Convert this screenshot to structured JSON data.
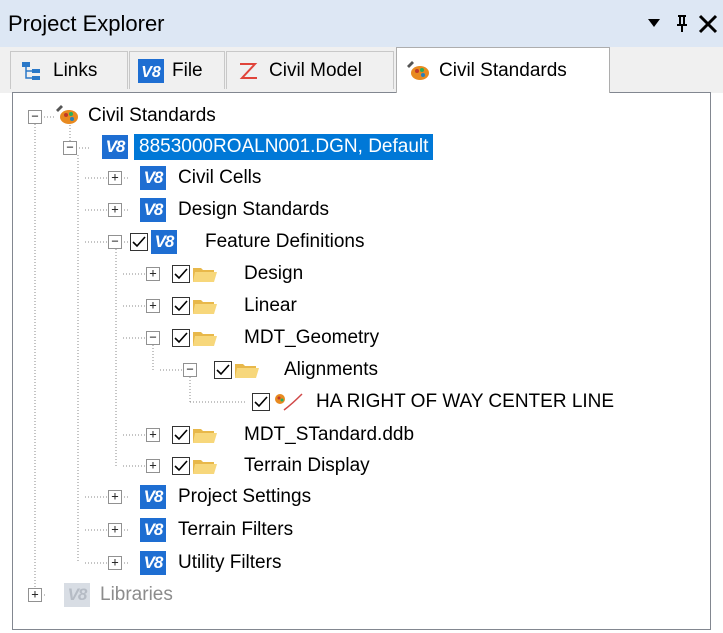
{
  "window": {
    "title": "Project Explorer",
    "dropdown_glyph": "▼",
    "pin_glyph": "ᵖ",
    "close_glyph": "✕"
  },
  "tabs": [
    {
      "label": "Links",
      "icon": "links-icon",
      "active": false
    },
    {
      "label": "File",
      "icon": "v8-icon",
      "active": false
    },
    {
      "label": "Civil Model",
      "icon": "civil-model-icon",
      "active": false
    },
    {
      "label": "Civil Standards",
      "icon": "civil-standards-icon",
      "active": true
    }
  ],
  "tree": {
    "root_label": "Civil Standards",
    "dgn_label": "8853000ROALN001.DGN, Default",
    "civil_cells": "Civil Cells",
    "design_standards": "Design Standards",
    "feature_definitions": "Feature Definitions",
    "design": "Design",
    "linear": "Linear",
    "mdt_geometry": "MDT_Geometry",
    "alignments": "Alignments",
    "ha_row": "HA RIGHT OF WAY CENTER LINE",
    "mdt_standard": "MDT_STandard.ddb",
    "terrain_display": "Terrain Display",
    "project_settings": "Project Settings",
    "terrain_filters": "Terrain Filters",
    "utility_filters": "Utility Filters",
    "libraries": "Libraries",
    "v8_badge": "V8",
    "expand_glyph": "+",
    "collapse_glyph": "−"
  },
  "colors": {
    "selection": "#0078d7",
    "v8_blue": "#1e6ed2",
    "folder": "#f7cf6b",
    "titlebar": "#dde7f4"
  }
}
